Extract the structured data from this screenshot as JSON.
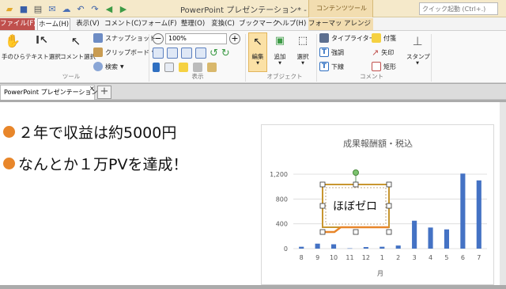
{
  "window": {
    "title": "PowerPoint プレゼンテーション* - PDF-XCh...",
    "context_group": "コンテンツツール"
  },
  "search": {
    "placeholder": "クイック起動 (Ctrl+.)"
  },
  "menu_tabs": [
    "ファイル(F)",
    "ホーム(H)",
    "表示(V)",
    "コメント(C)",
    "フォーム(F)",
    "整理(O)",
    "変換(C)",
    "ブックマーク",
    "ヘルプ(H)",
    "フォーマット",
    "アレンジ"
  ],
  "ribbon": {
    "tools": {
      "hand": "手のひら",
      "text_select": "テキスト選択",
      "comment_select": "コメント選択",
      "snapshot": "スナップショット",
      "clipboard": "クリップボード",
      "search": "検索",
      "group": "ツール"
    },
    "view": {
      "zoom": "100%",
      "group": "表示"
    },
    "object": {
      "edit": "編集",
      "add": "追加",
      "select": "選択",
      "group": "オブジェクト"
    },
    "comment": {
      "typewriter": "タイプライター",
      "sticky": "付箋",
      "highlight": "強調",
      "arrow": "矢印",
      "underline": "下線",
      "rect": "矩形",
      "stamp": "スタンプ",
      "group": "コメント"
    }
  },
  "doc_tab": {
    "label": "PowerPoint プレゼンテーション *",
    "close": "×",
    "new": "+"
  },
  "slide": {
    "bullets": [
      "２年で収益は約5000円",
      "なんとか１万PVを達成！"
    ],
    "callout": "ほぼゼロ"
  },
  "colors": {
    "file_tab": "#c0504d",
    "bullet": "#e8862a",
    "bar": "#4472c4",
    "callout_line": "#e8862a"
  },
  "chart_data": {
    "type": "bar",
    "title": "成果報酬額・税込",
    "xlabel": "月",
    "ylabel": "",
    "categories": [
      "8",
      "9",
      "10",
      "11",
      "12",
      "1",
      "2",
      "3",
      "4",
      "5",
      "6",
      "7"
    ],
    "values": [
      30,
      80,
      70,
      5,
      25,
      30,
      50,
      450,
      340,
      310,
      1210,
      1100
    ],
    "ylim": [
      0,
      1200
    ],
    "yticks": [
      "0",
      "400",
      "800",
      "1,200"
    ],
    "grid": true
  }
}
